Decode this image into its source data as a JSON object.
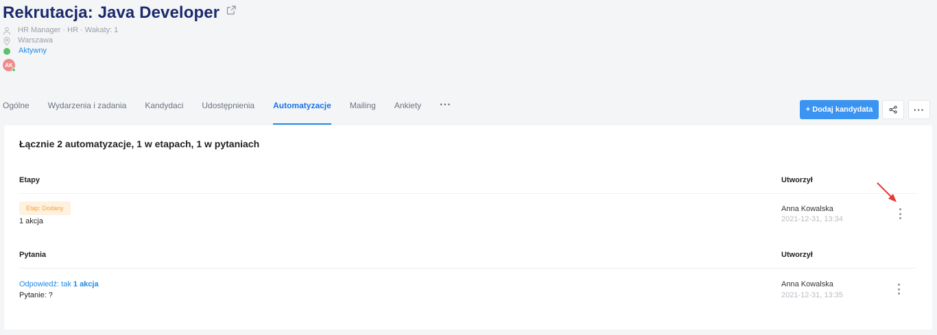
{
  "header": {
    "title": "Rekrutacja: Java Developer",
    "meta_role": "HR Manager · HR · Wakaty: 1",
    "location": "Warszawa",
    "status": "Aktywny",
    "avatar_initials": "AK"
  },
  "tabs": [
    {
      "label": "Ogólne",
      "active": false
    },
    {
      "label": "Wydarzenia i zadania",
      "active": false
    },
    {
      "label": "Kandydaci",
      "active": false
    },
    {
      "label": "Udostępnienia",
      "active": false
    },
    {
      "label": "Automatyzacje",
      "active": true
    },
    {
      "label": "Mailing",
      "active": false
    },
    {
      "label": "Ankiety",
      "active": false
    }
  ],
  "tabs_more": "···",
  "actions": {
    "add_candidate": "+ Dodaj kandydata",
    "more": "···"
  },
  "content": {
    "summary": "Łącznie 2 automatyzacje, 1 w etapach, 1 w pytaniach",
    "stages": {
      "header": "Etapy",
      "creator_header": "Utworzył",
      "rows": [
        {
          "badge": "Etap: Dodany",
          "actions": "1 akcja",
          "creator": "Anna Kowalska",
          "date": "2021-12-31, 13:34"
        }
      ]
    },
    "questions": {
      "header": "Pytania",
      "creator_header": "Utworzył",
      "rows": [
        {
          "answer": "Odpowiedź: tak",
          "actions": "1 akcja",
          "question": "Pytanie: ?",
          "creator": "Anna Kowalska",
          "date": "2021-12-31, 13:35"
        }
      ]
    }
  },
  "colors": {
    "title": "#1a2a6c",
    "accent": "#1e88e5",
    "primary_button": "#3b93f2",
    "status_green": "#5cc16a",
    "badge_bg": "#fff1df",
    "badge_text": "#f3a33b",
    "arrow": "#e53935"
  }
}
